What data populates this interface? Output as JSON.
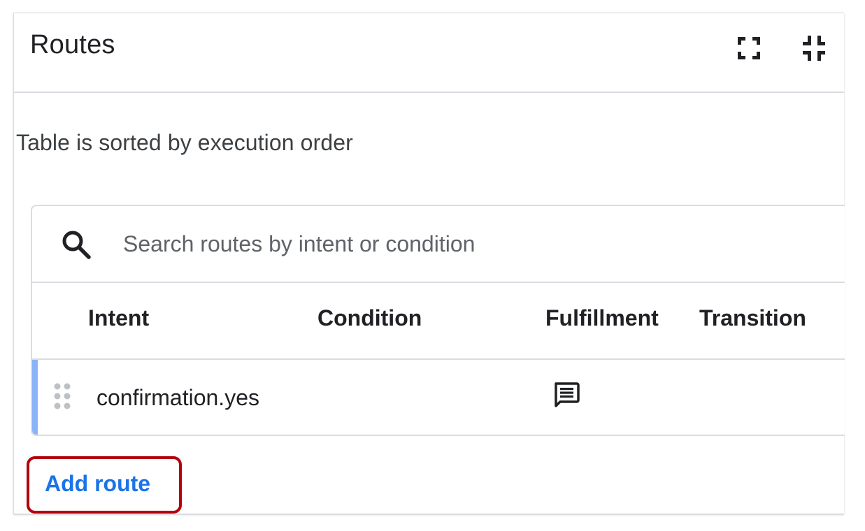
{
  "panel": {
    "title": "Routes",
    "icons": [
      "fullscreen-icon",
      "fullscreen-exit-icon"
    ]
  },
  "sort_note": "Table is sorted by execution order",
  "search": {
    "placeholder": "Search routes by intent or condition",
    "value": "",
    "icon": "search-icon"
  },
  "table": {
    "columns": [
      "Intent",
      "Condition",
      "Fulfillment",
      "Transition"
    ],
    "rows": [
      {
        "intent": "confirmation.yes",
        "condition": "",
        "fulfillment_icon": "message-icon",
        "transition": ""
      }
    ]
  },
  "add_route_label": "Add route",
  "colors": {
    "accent_blue": "#1a73e8",
    "row_marker": "#8ab4f8",
    "highlight": "#b3000c",
    "border": "#dadce0"
  }
}
